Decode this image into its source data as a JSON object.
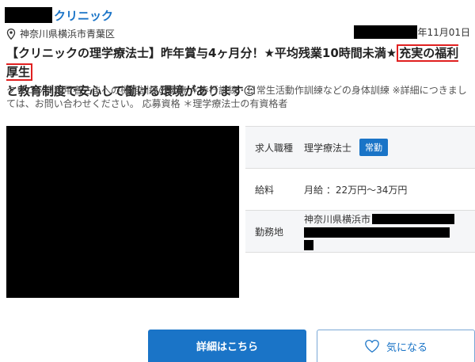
{
  "header": {
    "clinic_suffix": "クリニック",
    "location": "神奈川県横浜市青葉区",
    "date_suffix": "年11月01日"
  },
  "title": {
    "main": "【クリニックの理学療法士】昨年賞与4ヶ月分！★平均残業10時間未満★",
    "highlight": "充実の福利厚生",
    "rest": "と教育制度で安心して働ける環境があります☺"
  },
  "description": "クリニック利用者さまへの機能訓練の実施 ＊歩行訓練・日常生活動作訓練などの身体訓練 ※詳細につきましては、お問い合わせください。 応募資格 ＊理学療法士の有資格者",
  "info": {
    "job_type_label": "求人職種",
    "job_type_value": "理学療法士",
    "job_type_badge": "常勤",
    "salary_label": "給料",
    "salary_value": "月給 ：22万円～34万円",
    "location_label": "勤務地",
    "location_value": "神奈川県横浜市"
  },
  "buttons": {
    "detail": "詳細はこちら",
    "favorite": "気になる"
  },
  "colors": {
    "accent": "#1a74c7",
    "highlight_border": "#e02020"
  },
  "icons": {
    "location": "map-pin-icon",
    "favorite": "heart-outline-icon"
  }
}
